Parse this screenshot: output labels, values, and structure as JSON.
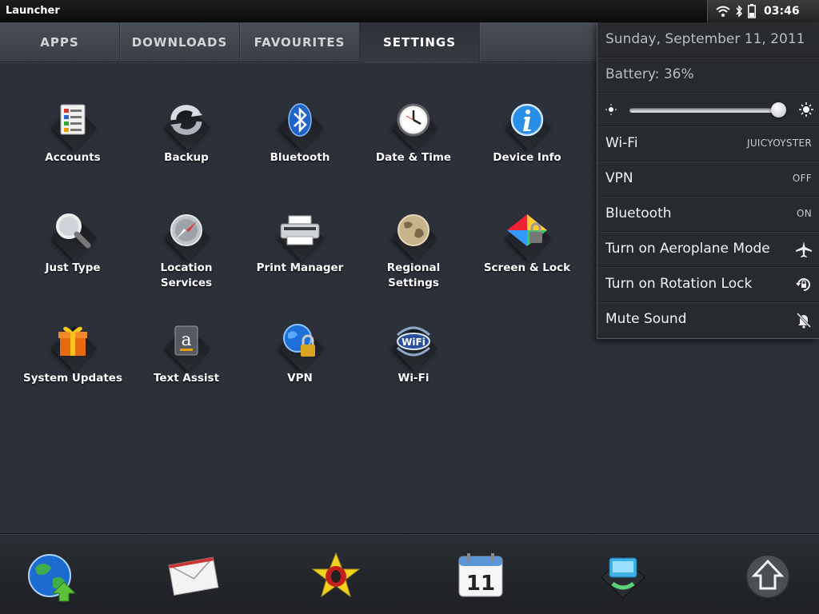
{
  "statusbar": {
    "title": "Launcher",
    "time": "03:46",
    "icons": [
      "wifi-icon",
      "bluetooth-icon",
      "battery-icon"
    ]
  },
  "tabs": [
    {
      "label": "APPS",
      "active": false
    },
    {
      "label": "DOWNLOADS",
      "active": false
    },
    {
      "label": "FAVOURITES",
      "active": false
    },
    {
      "label": "SETTINGS",
      "active": true
    }
  ],
  "settings_apps": [
    {
      "label": "Accounts",
      "icon": "accounts-icon"
    },
    {
      "label": "Backup",
      "icon": "backup-icon"
    },
    {
      "label": "Bluetooth",
      "icon": "bluetooth-app-icon"
    },
    {
      "label": "Date & Time",
      "icon": "clock-icon"
    },
    {
      "label": "Device Info",
      "icon": "info-icon"
    },
    {
      "label": "Just Type",
      "icon": "magnifier-icon"
    },
    {
      "label": "Location Services",
      "icon": "compass-icon"
    },
    {
      "label": "Print Manager",
      "icon": "printer-icon"
    },
    {
      "label": "Regional Settings",
      "icon": "globe-icon"
    },
    {
      "label": "Screen & Lock",
      "icon": "screen-lock-icon"
    },
    {
      "label": "System Updates",
      "icon": "gift-icon"
    },
    {
      "label": "Text Assist",
      "icon": "text-assist-icon"
    },
    {
      "label": "VPN",
      "icon": "vpn-globe-lock-icon"
    },
    {
      "label": "Wi-Fi",
      "icon": "wifi-app-icon"
    }
  ],
  "menu": {
    "date": "Sunday, September 11, 2011",
    "battery": "Battery: 36%",
    "brightness": 0.95,
    "rows": [
      {
        "label": "Wi-Fi",
        "value": "JUICYOYSTER"
      },
      {
        "label": "VPN",
        "value": "OFF"
      },
      {
        "label": "Bluetooth",
        "value": "ON"
      },
      {
        "label": "Turn on Aeroplane Mode",
        "icon": "airplane-icon"
      },
      {
        "label": "Turn on Rotation Lock",
        "icon": "rotation-lock-icon"
      },
      {
        "label": "Mute Sound",
        "icon": "mute-bell-icon"
      }
    ]
  },
  "dock": [
    {
      "icon": "browser-globe-icon"
    },
    {
      "icon": "email-icon"
    },
    {
      "icon": "star-app-icon"
    },
    {
      "icon": "calendar-icon",
      "text": "11"
    },
    {
      "icon": "phone-app-icon"
    },
    {
      "icon": "launcher-up-icon"
    }
  ]
}
